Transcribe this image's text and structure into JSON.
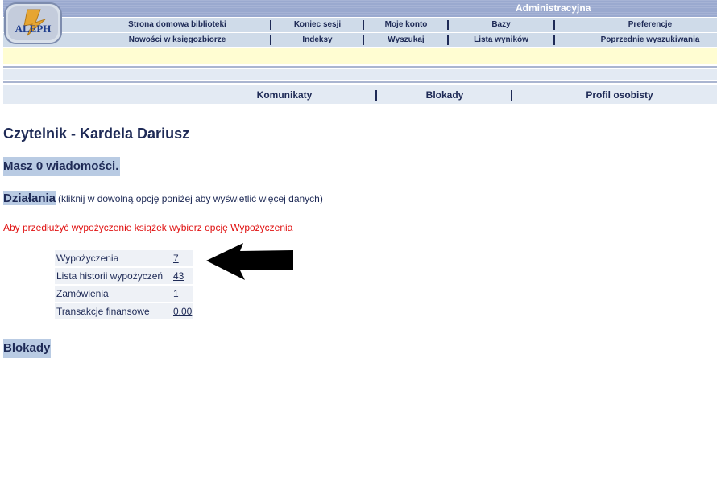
{
  "logo": {
    "text": "ALEPH"
  },
  "header": {
    "admin_label": "Administracyjna"
  },
  "nav": {
    "row1": [
      "Strona domowa biblioteki",
      "Koniec sesji",
      "Moje konto",
      "Bazy",
      "Preferencje"
    ],
    "row2": [
      "Nowości w księgozbiorze",
      "Indeksy",
      "Wyszukaj",
      "Lista wyników",
      "Poprzednie wyszukiwania"
    ]
  },
  "tabs": [
    "Komunikaty",
    "Blokady",
    "Profil osobisty"
  ],
  "page": {
    "title": "Czytelnik - Kardela Dariusz",
    "messages": "Masz 0 wiadomości.",
    "actions_heading": "Działania",
    "actions_hint": "(kliknij w dowolną opcję poniżej aby wyświetlić więcej danych)",
    "renew_notice": "Aby przedłużyć wypożyczenie książek wybierz opcję Wypożyczenia",
    "blocks_heading": "Blokady"
  },
  "actions_table": [
    {
      "label": "Wypożyczenia",
      "value": "7"
    },
    {
      "label": "Lista historii wypożyczeń",
      "value": "43"
    },
    {
      "label": "Zamówienia",
      "value": "1"
    },
    {
      "label": "Transakcje finansowe",
      "value": "0.00"
    }
  ],
  "colors": {
    "header_bar": "#9aa9cf",
    "nav_bg": "#cfdbe9",
    "highlight": "#b9cbe3",
    "notice_red": "#e01010",
    "text": "#1e2a56",
    "arrow": "#000000"
  }
}
